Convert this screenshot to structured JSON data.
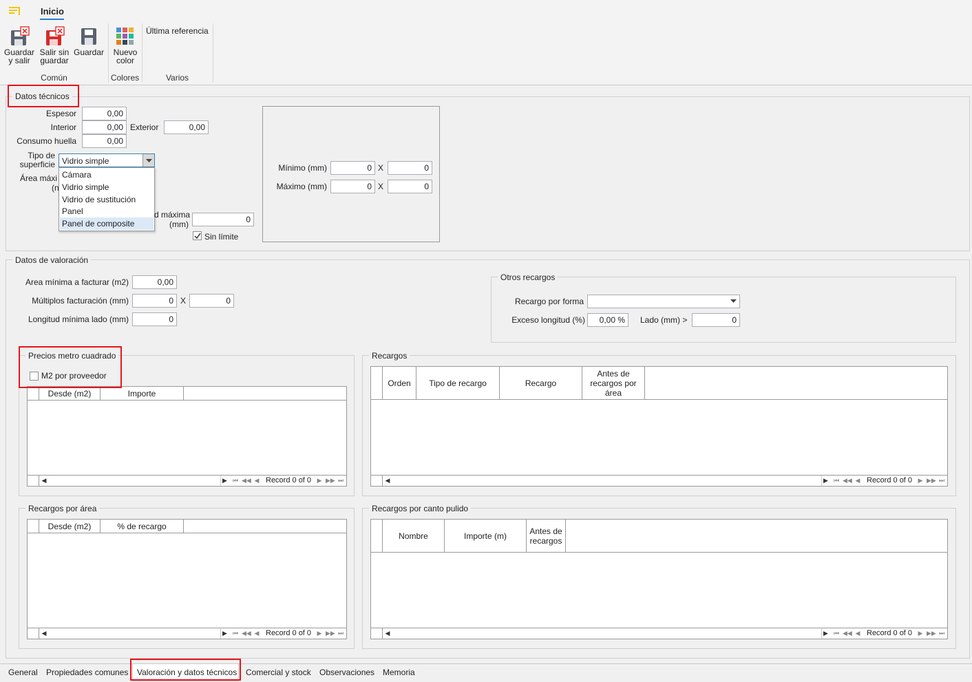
{
  "ribbon": {
    "tab": "Inicio",
    "buttons": {
      "save_exit_1": "Guardar",
      "save_exit_2": "y salir",
      "exit_nosave_1": "Salir sin",
      "exit_nosave_2": "guardar",
      "save": "Guardar",
      "new_color_1": "Nuevo",
      "new_color_2": "color",
      "last_ref": "Última referencia"
    },
    "groups": {
      "common": "Común",
      "colors": "Colores",
      "misc": "Varios"
    }
  },
  "tech": {
    "legend": "Datos técnicos",
    "espesor_label": "Espesor",
    "espesor": "0,00",
    "interior_label": "Interior",
    "interior": "0,00",
    "exterior_label": "Exterior",
    "exterior": "0,00",
    "huella_label": "Consumo huella",
    "huella": "0,00",
    "tipo_label_1": "Tipo de",
    "tipo_label_2": "superficie",
    "tipo_value": "Vidrio simple",
    "area_label_1": "Área máxi",
    "area_label_2": "(n",
    "long_label_1": "d máxima",
    "long_label_2": "(mm)",
    "long_value": "0",
    "sin_limite": "Sin límite",
    "dropdown": [
      "Cámara",
      "Vidrio simple",
      "Vidrio de sustitución",
      "Panel",
      "Panel de composite"
    ],
    "min_label": "Mínimo (mm)",
    "min_a": "0",
    "min_b": "0",
    "max_label": "Máximo (mm)",
    "max_a": "0",
    "max_b": "0",
    "x": "X"
  },
  "valor": {
    "legend": "Datos de valoración",
    "area_min_label": "Area mínima a facturar (m2)",
    "area_min": "0,00",
    "multiplos_label": "Múltiplos facturación (mm)",
    "mult_a": "0",
    "mult_b": "0",
    "long_min_label": "Longitud mínima lado (mm)",
    "long_min": "0",
    "x": "X",
    "otros": {
      "legend": "Otros recargos",
      "forma_label": "Recargo por forma",
      "forma_value": "",
      "exceso_label": "Exceso longitud (%)",
      "exceso": "0,00 %",
      "lado_label": "Lado (mm) >",
      "lado": "0"
    }
  },
  "precios": {
    "legend": "Precios metro cuadrado",
    "m2_prov": "M2 por proveedor",
    "columns": [
      "Desde (m2)",
      "Importe"
    ],
    "record": "Record 0 of 0"
  },
  "recargos": {
    "legend": "Recargos",
    "columns": [
      "Orden",
      "Tipo de recargo",
      "Recargo",
      "Antes de recargos por área"
    ],
    "record": "Record 0 of 0"
  },
  "rec_area": {
    "legend": "Recargos por área",
    "columns": [
      "Desde (m2)",
      "% de recargo"
    ],
    "record": "Record 0 of 0"
  },
  "rec_canto": {
    "legend": "Recargos por canto pulido",
    "columns": [
      "Nombre",
      "Importe (m)",
      "Antes de recargos"
    ],
    "record": "Record 0 of 0"
  },
  "tabs": [
    "General",
    "Propiedades comunes",
    "Valoración y datos técnicos",
    "Comercial y stock",
    "Observaciones",
    "Memoria"
  ],
  "colors": {
    "accent": "#f5c400",
    "highlight": "#e8141c",
    "tab_underline": "#2b7cd3"
  }
}
